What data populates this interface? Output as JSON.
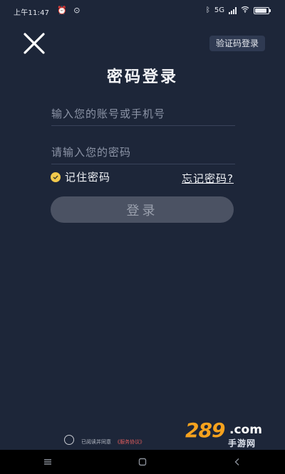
{
  "status_bar": {
    "time": "上午11:47",
    "icons_left": [
      "alarm-icon",
      "clock-icon"
    ],
    "icons_right": [
      "bluetooth-icon",
      "signal-icon",
      "wifi-icon",
      "battery-icon"
    ],
    "signal_label": "5G",
    "battery_level": 0.9
  },
  "header": {
    "close_icon": "close-icon",
    "sms_login_label": "验证码登录",
    "title": "密码登录"
  },
  "form": {
    "account_placeholder": "输入您的账号或手机号",
    "account_value": "",
    "password_placeholder": "请输入您的密码",
    "password_value": "",
    "remember_label": "记住密码",
    "remember_checked": true,
    "forgot_label": "忘记密码?",
    "login_label": "登录"
  },
  "agreement": {
    "text": "已阅读并同意",
    "link": "《服务协议》"
  },
  "watermark": {
    "number": "289",
    "domain": ".com",
    "subtitle": "手游网"
  },
  "colors": {
    "background": "#1d2639",
    "accent_yellow": "#f2c94c",
    "login_button": "#4b5263",
    "watermark_orange": "#f6a21e",
    "agreement_link": "#e35d5d"
  }
}
